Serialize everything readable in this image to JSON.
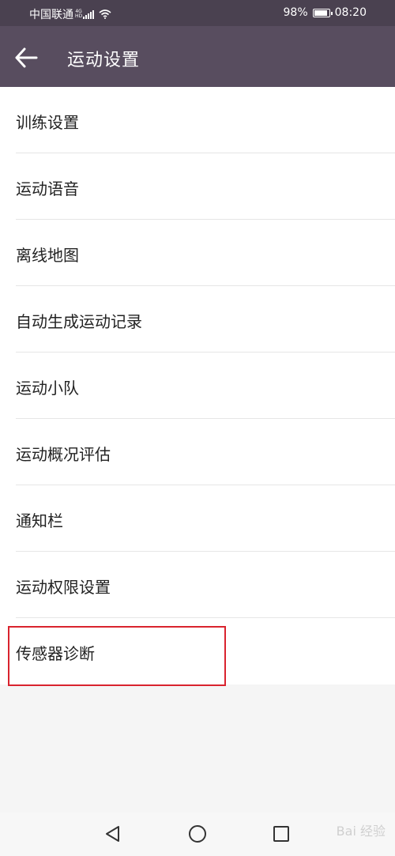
{
  "status_bar": {
    "carrier": "中国联通",
    "network": "4G",
    "network_sub": "HD",
    "battery": "98%",
    "battery_level": 0.98,
    "time": "08:20"
  },
  "app_bar": {
    "title": "运动设置",
    "back_icon": "arrow-left-icon"
  },
  "settings_items": [
    {
      "label": "训练设置"
    },
    {
      "label": "运动语音"
    },
    {
      "label": "离线地图"
    },
    {
      "label": "自动生成运动记录"
    },
    {
      "label": "运动小队"
    },
    {
      "label": "运动概况评估"
    },
    {
      "label": "通知栏"
    },
    {
      "label": "运动权限设置"
    },
    {
      "label": "传感器诊断",
      "highlighted": true
    }
  ],
  "nav_bar": {
    "back_icon": "triangle-back-icon",
    "home_icon": "circle-home-icon",
    "recents_icon": "square-recents-icon"
  },
  "watermark": {
    "text": "Bai 经验"
  },
  "colors": {
    "status_bar_bg": "#4a4150",
    "app_bar_bg": "#584d5f",
    "highlight_border": "#d9232e"
  }
}
